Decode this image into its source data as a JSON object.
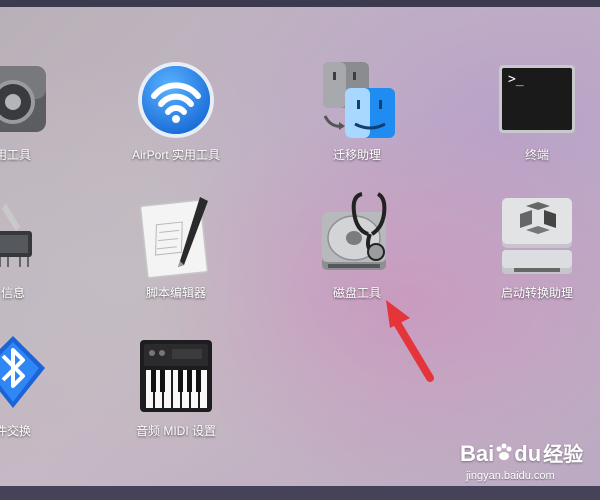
{
  "apps": [
    {
      "label": "用工具",
      "icon": "utility-tool-icon"
    },
    {
      "label": "AirPort 实用工具",
      "icon": "airport-wifi-icon"
    },
    {
      "label": "迁移助理",
      "icon": "migration-assistant-icon"
    },
    {
      "label": "终端",
      "icon": "terminal-icon"
    },
    {
      "label": "信息",
      "icon": "system-information-icon"
    },
    {
      "label": "脚本编辑器",
      "icon": "script-editor-icon"
    },
    {
      "label": "磁盘工具",
      "icon": "disk-utility-icon"
    },
    {
      "label": "启动转换助理",
      "icon": "boot-camp-assistant-icon"
    },
    {
      "label": "件交换",
      "icon": "bluetooth-file-exchange-icon"
    },
    {
      "label": "音频 MIDI 设置",
      "icon": "audio-midi-setup-icon"
    }
  ],
  "terminal_prompt": ">_",
  "annotation": {
    "icon": "red-arrow-icon",
    "color": "#e5343a"
  },
  "watermark": {
    "brand": "Bai",
    "brand_suffix": "du",
    "product": "经验",
    "url": "jingyan.baidu.com"
  }
}
